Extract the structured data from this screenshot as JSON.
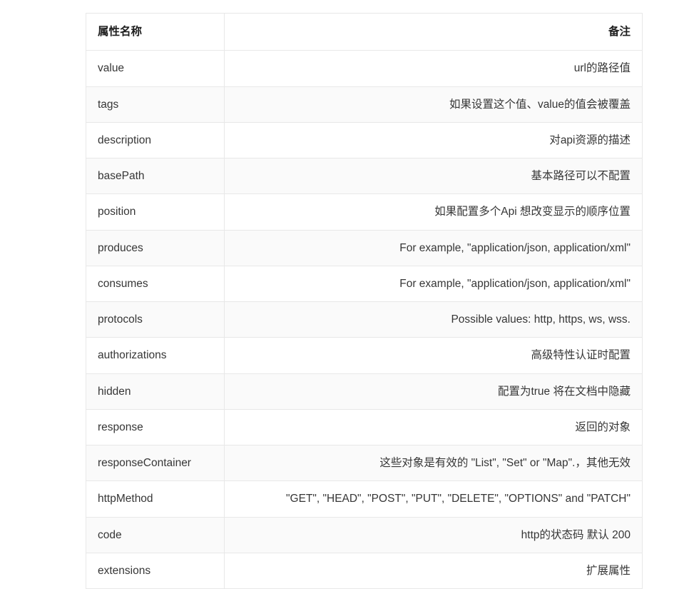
{
  "table": {
    "headers": {
      "name": "属性名称",
      "remark": "备注"
    },
    "rows": [
      {
        "name": "value",
        "remark": "url的路径值"
      },
      {
        "name": "tags",
        "remark": "如果设置这个值、value的值会被覆盖"
      },
      {
        "name": "description",
        "remark": "对api资源的描述"
      },
      {
        "name": "basePath",
        "remark": "基本路径可以不配置"
      },
      {
        "name": "position",
        "remark": "如果配置多个Api 想改变显示的顺序位置"
      },
      {
        "name": "produces",
        "remark": "For example, \"application/json, application/xml\""
      },
      {
        "name": "consumes",
        "remark": "For example, \"application/json, application/xml\""
      },
      {
        "name": "protocols",
        "remark": "Possible values: http, https, ws, wss."
      },
      {
        "name": "authorizations",
        "remark": "高级特性认证时配置"
      },
      {
        "name": "hidden",
        "remark": "配置为true 将在文档中隐藏"
      },
      {
        "name": "response",
        "remark": "返回的对象"
      },
      {
        "name": "responseContainer",
        "remark": "这些对象是有效的 \"List\", \"Set\" or \"Map\".，其他无效"
      },
      {
        "name": "httpMethod",
        "remark": "\"GET\", \"HEAD\", \"POST\", \"PUT\", \"DELETE\", \"OPTIONS\" and \"PATCH\""
      },
      {
        "name": "code",
        "remark": "http的状态码 默认 200"
      },
      {
        "name": "extensions",
        "remark": "扩展属性"
      }
    ]
  },
  "colors": {
    "border": "#e8e8e8",
    "stripe": "#fafafa",
    "text": "#3a3a3a",
    "header_text": "#1d1d1d",
    "background": "#ffffff"
  }
}
